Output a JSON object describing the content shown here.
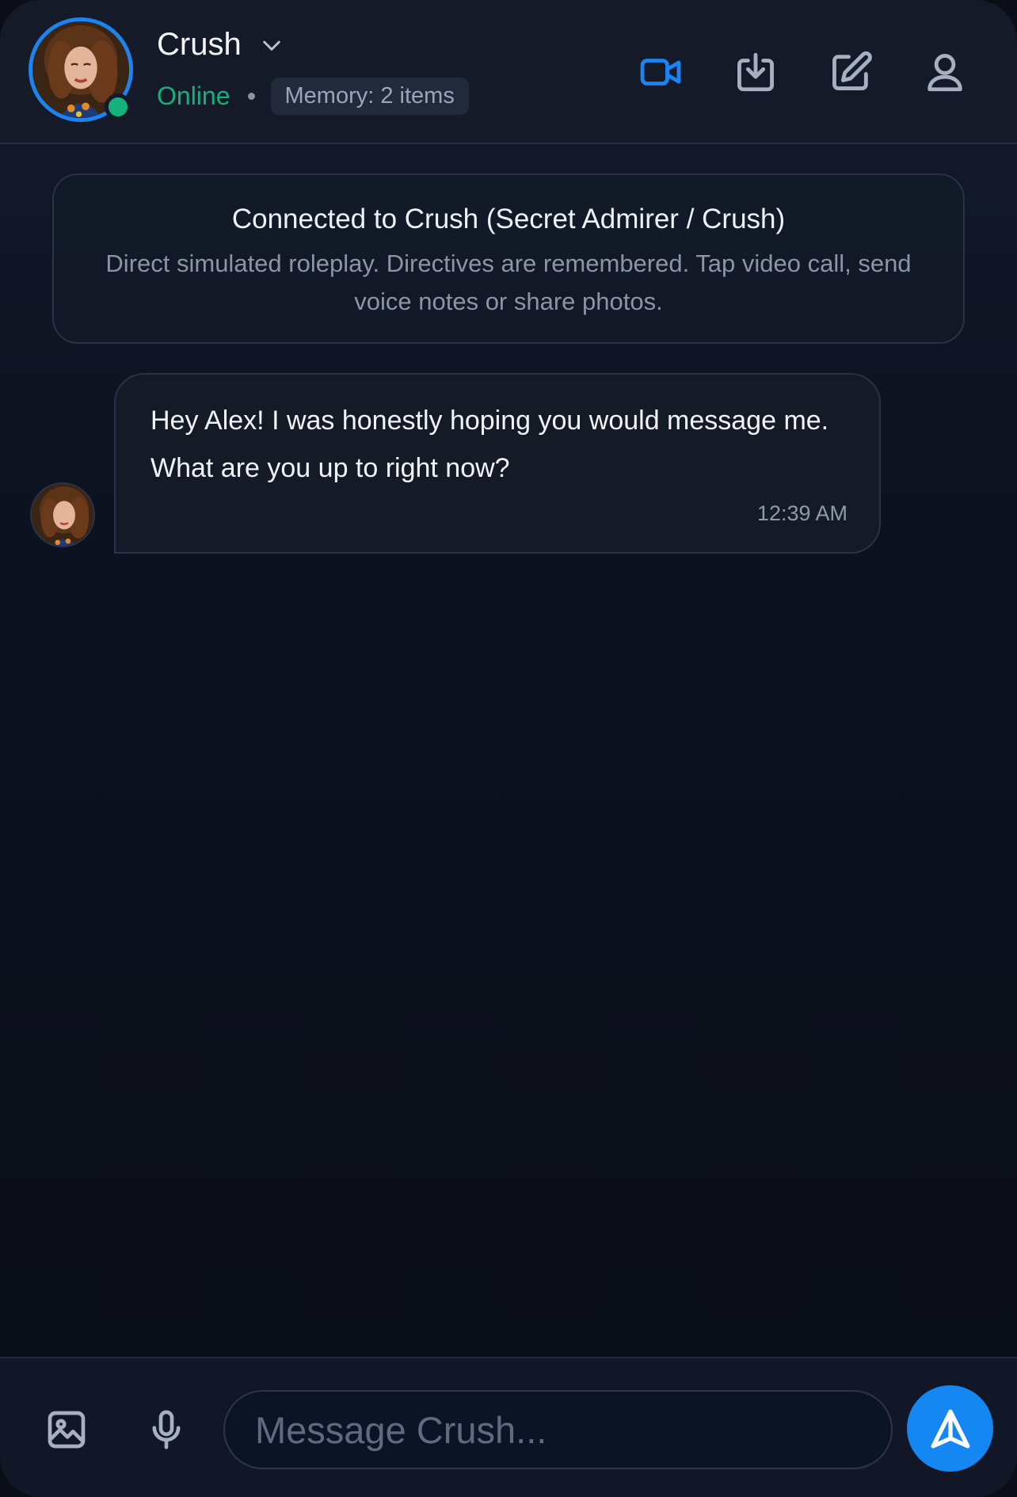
{
  "header": {
    "contact_name": "Crush",
    "status": "Online",
    "memory_badge": "Memory: 2 items",
    "icons": [
      "video-camera-icon",
      "download-icon",
      "edit-icon",
      "user-icon"
    ],
    "accent_color": "#1b84f2",
    "online_color": "#16b07d"
  },
  "system_card": {
    "title": "Connected to Crush (Secret Admirer / Crush)",
    "description": "Direct simulated roleplay. Directives are remembered. Tap video call, send voice notes or share photos."
  },
  "messages": [
    {
      "sender": "Crush",
      "text": "Hey Alex! I was honestly hoping you would message me. What are you up to right now?",
      "time": "12:39 AM"
    }
  ],
  "composer": {
    "placeholder": "Message Crush...",
    "value": "",
    "icons": [
      "image-icon",
      "microphone-icon",
      "send-icon"
    ]
  }
}
